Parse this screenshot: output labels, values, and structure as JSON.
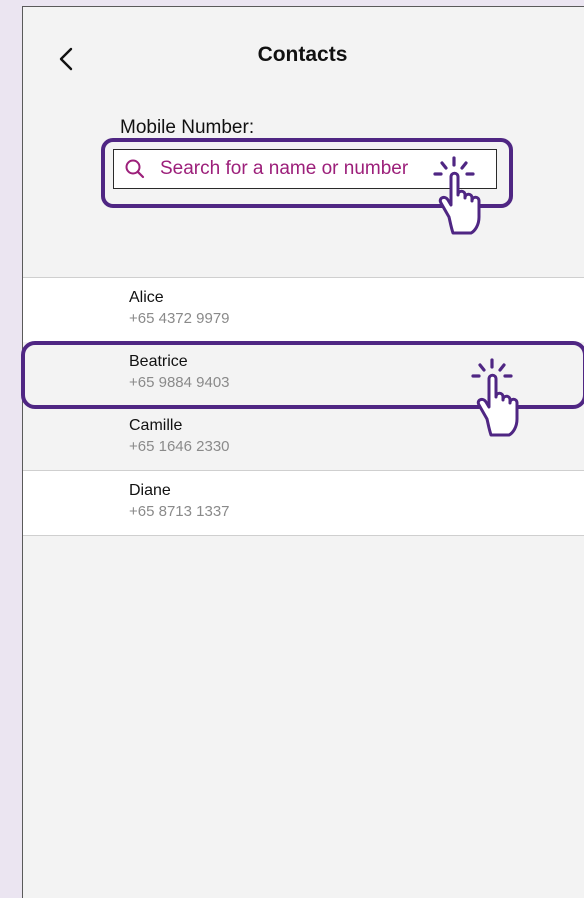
{
  "header": {
    "back_icon": "chevron-left-icon",
    "title": "Contacts"
  },
  "search": {
    "label": "Mobile Number:",
    "icon": "search-icon",
    "placeholder": "Search for a name or number"
  },
  "contacts": [
    {
      "name": "Alice",
      "phone": "+65 4372 9979"
    },
    {
      "name": "Beatrice",
      "phone": "+65 9884 9403"
    },
    {
      "name": "Camille",
      "phone": "+65 1646 2330"
    },
    {
      "name": "Diane",
      "phone": "+65 8713 1337"
    }
  ],
  "colors": {
    "accent": "#4f2683",
    "placeholder": "#9c1f7a",
    "background": "#f3f3f3",
    "outer_background": "#ebe5f1"
  },
  "annotations": {
    "tap_icon": "tap-hand-icon"
  }
}
